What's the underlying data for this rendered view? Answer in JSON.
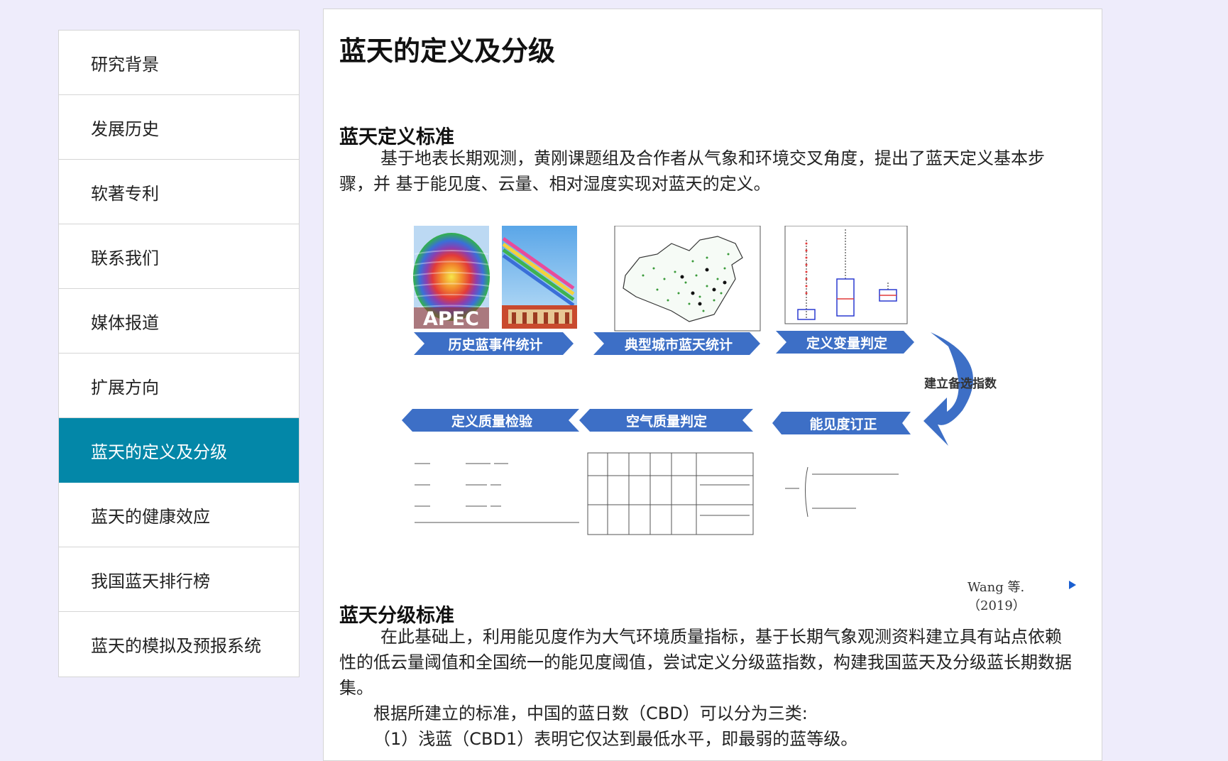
{
  "sidebar": {
    "items": [
      {
        "label": "研究背景"
      },
      {
        "label": "发展历史"
      },
      {
        "label": "软著专利"
      },
      {
        "label": "联系我们"
      },
      {
        "label": "媒体报道"
      },
      {
        "label": "扩展方向"
      },
      {
        "label": "蓝天的定义及分级"
      },
      {
        "label": "蓝天的健康效应"
      },
      {
        "label": "我国蓝天排行榜"
      },
      {
        "label": "蓝天的模拟及预报系统"
      }
    ],
    "active_label": "蓝天的定义及分级"
  },
  "main": {
    "title": "蓝天的定义及分级",
    "section1": {
      "title": "蓝天定义标准",
      "text": "基于地表长期观测，黄刚课题组及合作者从气象和环境交叉角度，提出了蓝天定义基本步骤，并 基于能见度、云量、相对湿度实现对蓝天的定义。"
    },
    "figure": {
      "apec_text": "APEC",
      "steps_top": [
        "历史蓝事件统计",
        "典型城市蓝天统计",
        "定义变量判定"
      ],
      "steps_bottom": [
        "定义质量检验",
        "空气质量判定",
        "能见度订正"
      ],
      "side_label": "建立备选指数",
      "caption": "Wang 等.（2019）"
    },
    "section2": {
      "title": "蓝天分级标准",
      "text1": "在此基础上，利用能见度作为大气环境质量指标，基于长期气象观测资料建立具有站点依赖性的低云量阈值和全国统一的能见度阈值，尝试定义分级蓝指数，构建我国蓝天及分级蓝长期数据集。",
      "text2": "根据所建立的标准，中国的蓝日数（CBD）可以分为三类:",
      "text3": "（1）浅蓝（CBD1）表明它仅达到最低水平，即最弱的蓝等级。"
    }
  },
  "colors": {
    "background": "#eeecfb",
    "active_nav": "#0387a8",
    "banner_blue": "#3d6fc6"
  }
}
